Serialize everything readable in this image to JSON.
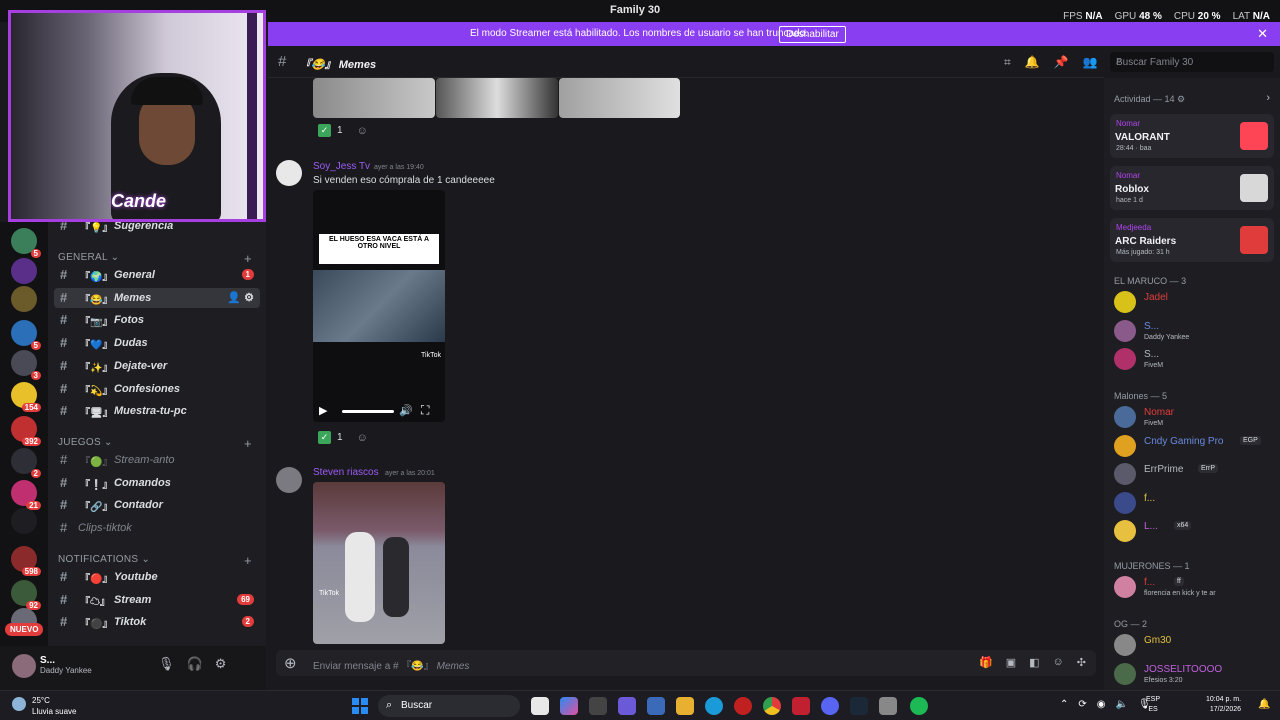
{
  "titlebar": {
    "title": "Family 30",
    "fps_label": "FPS",
    "fps_value": "N/A",
    "gpu_label": "GPU",
    "gpu_value": "48 %",
    "cpu_label": "CPU",
    "cpu_value": "20 %",
    "lat_label": "LAT",
    "lat_value": "N/A"
  },
  "banner": {
    "text": "El modo Streamer está habilitado. Los nombres de usuario se han truncado.",
    "button": "Deshabilitar"
  },
  "webcam": {
    "logo_text": "Cande"
  },
  "servers": [
    {
      "badge": "5",
      "color": "#3a7f5a"
    },
    {
      "badge": "",
      "color": "#5a2f8a"
    },
    {
      "badge": "",
      "color": "#6b5a2a"
    },
    {
      "badge": "5",
      "color": "#2a6fb8"
    },
    {
      "badge": "3",
      "color": "#4a4a56"
    },
    {
      "badge": "154",
      "color": "#e8c02a"
    },
    {
      "badge": "392",
      "color": "#c03030"
    },
    {
      "badge": "2",
      "color": "#2e2e36"
    },
    {
      "badge": "21",
      "color": "#c03070"
    },
    {
      "badge": "",
      "color": "#1e1e22"
    },
    {
      "badge": "598",
      "color": "#8a2a2a"
    },
    {
      "badge": "92",
      "color": "#3a5a3a"
    },
    {
      "badge": "",
      "color": "#6a6a76"
    }
  ],
  "new_badge": "NUEVO",
  "channels": {
    "top_partial": "Sugerencia",
    "categories": [
      "GENERAL",
      "JUEGOS",
      "NOTIFICATIONS"
    ],
    "general": [
      {
        "name": "General",
        "icon": "🌍",
        "count": "1"
      },
      {
        "name": "Memes",
        "icon": "😂",
        "count": ""
      },
      {
        "name": "Fotos",
        "icon": "📷",
        "count": ""
      },
      {
        "name": "Dudas",
        "icon": "💙",
        "count": ""
      },
      {
        "name": "Dejate-ver",
        "icon": "✨",
        "count": ""
      },
      {
        "name": "Confesiones",
        "icon": "💫",
        "count": ""
      },
      {
        "name": "Muestra-tu-pc",
        "icon": "🖥",
        "count": ""
      }
    ],
    "juegos": [
      {
        "name": "Stream-anto",
        "icon": "🟢"
      },
      {
        "name": "Comandos",
        "icon": "❕"
      },
      {
        "name": "Contador",
        "icon": "🔗"
      },
      {
        "name": "Clips-tiktok",
        "icon": ""
      }
    ],
    "notifications": [
      {
        "name": "Youtube",
        "icon": "🔴",
        "count": ""
      },
      {
        "name": "Stream",
        "icon": "☁",
        "count": "69"
      },
      {
        "name": "Tiktok",
        "icon": "⚫",
        "count": "2"
      }
    ]
  },
  "user": {
    "name": "S...",
    "status": "Daddy Yankee"
  },
  "chat": {
    "channel_name": "Memes",
    "search_placeholder": "Buscar Family 30",
    "composer_placeholder": "Enviar mensaje a #",
    "composer_channel": "Memes",
    "messages": [
      {
        "author": "Soy_Jess Tv",
        "time": "ayer a las 19:40",
        "text": "Si venden eso cómprala de 1 candeeeee",
        "caption": "EL HUESO ESA VACA ESTÁ A OTRO NIVEL",
        "watermark": "TikTok",
        "reaction": "1"
      },
      {
        "author": "Steven riascos",
        "time": "ayer a las 20:01",
        "text": "",
        "caption": "",
        "watermark": "TikTok",
        "reaction": ""
      }
    ],
    "top_reaction": "1"
  },
  "members": {
    "activity_label": "Actividad — 14",
    "activities": [
      {
        "user": "Nomar",
        "game": "VALORANT",
        "sub": "28:44 · baa",
        "color": "#fd4556"
      },
      {
        "user": "Nomar",
        "game": "Roblox",
        "sub": "hace 1 d",
        "color": "#d8d8d8"
      },
      {
        "user": "Medjeeda",
        "game": "ARC Raiders",
        "sub": "Más jugado: 31 h",
        "color": "#e03c3c"
      }
    ],
    "groups": [
      {
        "label": "EL MARUCO — 3"
      },
      {
        "label": "Malones — 5"
      },
      {
        "label": "MUJERONES — 1"
      },
      {
        "label": "OG — 2"
      }
    ],
    "maruco": [
      {
        "name": "Jadel",
        "status": "",
        "color": "#d8c21a"
      },
      {
        "name": "S...",
        "status": "Daddy Yankee",
        "color": "#8a5a8a"
      },
      {
        "name": "S...",
        "status": "FiveM",
        "color": "#b0306a"
      }
    ],
    "malones": [
      {
        "name": "Nomar",
        "status": "FiveM",
        "tag": "",
        "color": "#4a6a9a"
      },
      {
        "name": "Cndy Gaming Pro",
        "status": "",
        "tag": "EGP",
        "color": "#e0a020"
      },
      {
        "name": "ErrPrime",
        "status": "",
        "tag": "ErrP",
        "color": "#5a5a6a"
      },
      {
        "name": "f...",
        "status": "",
        "tag": "",
        "color": "#3a4a8a"
      },
      {
        "name": "L...",
        "status": "",
        "tag": "x64",
        "color": "#e8c040"
      }
    ],
    "mujerones": [
      {
        "name": "f...",
        "status": "florencia en kick y te ar",
        "tag": "ff",
        "color": "#d080a0"
      }
    ],
    "og": [
      {
        "name": "Gm30",
        "status": "",
        "color": "#888"
      },
      {
        "name": "JOSSELITOOOO",
        "status": "Efesios 3:20",
        "color": "#4a6a4a"
      }
    ]
  },
  "taskbar": {
    "temp": "25°C",
    "weather": "Lluvia suave",
    "search": "Buscar",
    "lang1": "ESP",
    "lang2": "ES",
    "time": "10:04 p. m.",
    "date": "17/2/2026"
  }
}
